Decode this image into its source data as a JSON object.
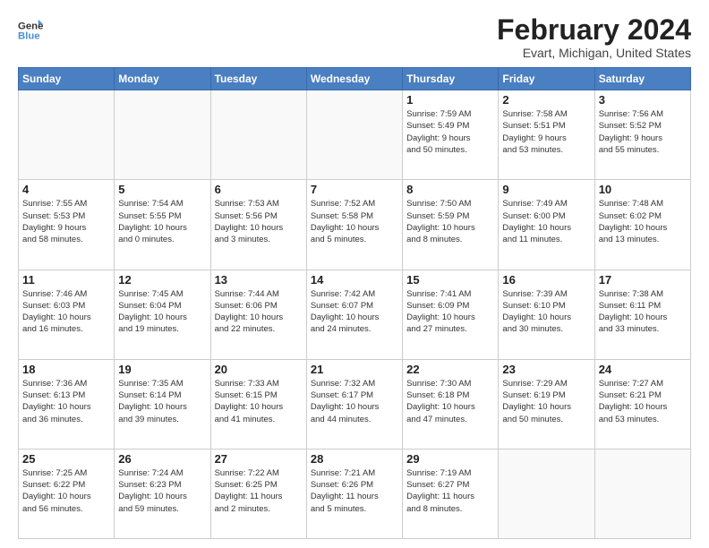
{
  "logo": {
    "line1": "General",
    "line2": "Blue"
  },
  "title": "February 2024",
  "subtitle": "Evart, Michigan, United States",
  "days_of_week": [
    "Sunday",
    "Monday",
    "Tuesday",
    "Wednesday",
    "Thursday",
    "Friday",
    "Saturday"
  ],
  "weeks": [
    [
      {
        "day": "",
        "info": ""
      },
      {
        "day": "",
        "info": ""
      },
      {
        "day": "",
        "info": ""
      },
      {
        "day": "",
        "info": ""
      },
      {
        "day": "1",
        "info": "Sunrise: 7:59 AM\nSunset: 5:49 PM\nDaylight: 9 hours\nand 50 minutes."
      },
      {
        "day": "2",
        "info": "Sunrise: 7:58 AM\nSunset: 5:51 PM\nDaylight: 9 hours\nand 53 minutes."
      },
      {
        "day": "3",
        "info": "Sunrise: 7:56 AM\nSunset: 5:52 PM\nDaylight: 9 hours\nand 55 minutes."
      }
    ],
    [
      {
        "day": "4",
        "info": "Sunrise: 7:55 AM\nSunset: 5:53 PM\nDaylight: 9 hours\nand 58 minutes."
      },
      {
        "day": "5",
        "info": "Sunrise: 7:54 AM\nSunset: 5:55 PM\nDaylight: 10 hours\nand 0 minutes."
      },
      {
        "day": "6",
        "info": "Sunrise: 7:53 AM\nSunset: 5:56 PM\nDaylight: 10 hours\nand 3 minutes."
      },
      {
        "day": "7",
        "info": "Sunrise: 7:52 AM\nSunset: 5:58 PM\nDaylight: 10 hours\nand 5 minutes."
      },
      {
        "day": "8",
        "info": "Sunrise: 7:50 AM\nSunset: 5:59 PM\nDaylight: 10 hours\nand 8 minutes."
      },
      {
        "day": "9",
        "info": "Sunrise: 7:49 AM\nSunset: 6:00 PM\nDaylight: 10 hours\nand 11 minutes."
      },
      {
        "day": "10",
        "info": "Sunrise: 7:48 AM\nSunset: 6:02 PM\nDaylight: 10 hours\nand 13 minutes."
      }
    ],
    [
      {
        "day": "11",
        "info": "Sunrise: 7:46 AM\nSunset: 6:03 PM\nDaylight: 10 hours\nand 16 minutes."
      },
      {
        "day": "12",
        "info": "Sunrise: 7:45 AM\nSunset: 6:04 PM\nDaylight: 10 hours\nand 19 minutes."
      },
      {
        "day": "13",
        "info": "Sunrise: 7:44 AM\nSunset: 6:06 PM\nDaylight: 10 hours\nand 22 minutes."
      },
      {
        "day": "14",
        "info": "Sunrise: 7:42 AM\nSunset: 6:07 PM\nDaylight: 10 hours\nand 24 minutes."
      },
      {
        "day": "15",
        "info": "Sunrise: 7:41 AM\nSunset: 6:09 PM\nDaylight: 10 hours\nand 27 minutes."
      },
      {
        "day": "16",
        "info": "Sunrise: 7:39 AM\nSunset: 6:10 PM\nDaylight: 10 hours\nand 30 minutes."
      },
      {
        "day": "17",
        "info": "Sunrise: 7:38 AM\nSunset: 6:11 PM\nDaylight: 10 hours\nand 33 minutes."
      }
    ],
    [
      {
        "day": "18",
        "info": "Sunrise: 7:36 AM\nSunset: 6:13 PM\nDaylight: 10 hours\nand 36 minutes."
      },
      {
        "day": "19",
        "info": "Sunrise: 7:35 AM\nSunset: 6:14 PM\nDaylight: 10 hours\nand 39 minutes."
      },
      {
        "day": "20",
        "info": "Sunrise: 7:33 AM\nSunset: 6:15 PM\nDaylight: 10 hours\nand 41 minutes."
      },
      {
        "day": "21",
        "info": "Sunrise: 7:32 AM\nSunset: 6:17 PM\nDaylight: 10 hours\nand 44 minutes."
      },
      {
        "day": "22",
        "info": "Sunrise: 7:30 AM\nSunset: 6:18 PM\nDaylight: 10 hours\nand 47 minutes."
      },
      {
        "day": "23",
        "info": "Sunrise: 7:29 AM\nSunset: 6:19 PM\nDaylight: 10 hours\nand 50 minutes."
      },
      {
        "day": "24",
        "info": "Sunrise: 7:27 AM\nSunset: 6:21 PM\nDaylight: 10 hours\nand 53 minutes."
      }
    ],
    [
      {
        "day": "25",
        "info": "Sunrise: 7:25 AM\nSunset: 6:22 PM\nDaylight: 10 hours\nand 56 minutes."
      },
      {
        "day": "26",
        "info": "Sunrise: 7:24 AM\nSunset: 6:23 PM\nDaylight: 10 hours\nand 59 minutes."
      },
      {
        "day": "27",
        "info": "Sunrise: 7:22 AM\nSunset: 6:25 PM\nDaylight: 11 hours\nand 2 minutes."
      },
      {
        "day": "28",
        "info": "Sunrise: 7:21 AM\nSunset: 6:26 PM\nDaylight: 11 hours\nand 5 minutes."
      },
      {
        "day": "29",
        "info": "Sunrise: 7:19 AM\nSunset: 6:27 PM\nDaylight: 11 hours\nand 8 minutes."
      },
      {
        "day": "",
        "info": ""
      },
      {
        "day": "",
        "info": ""
      }
    ]
  ]
}
